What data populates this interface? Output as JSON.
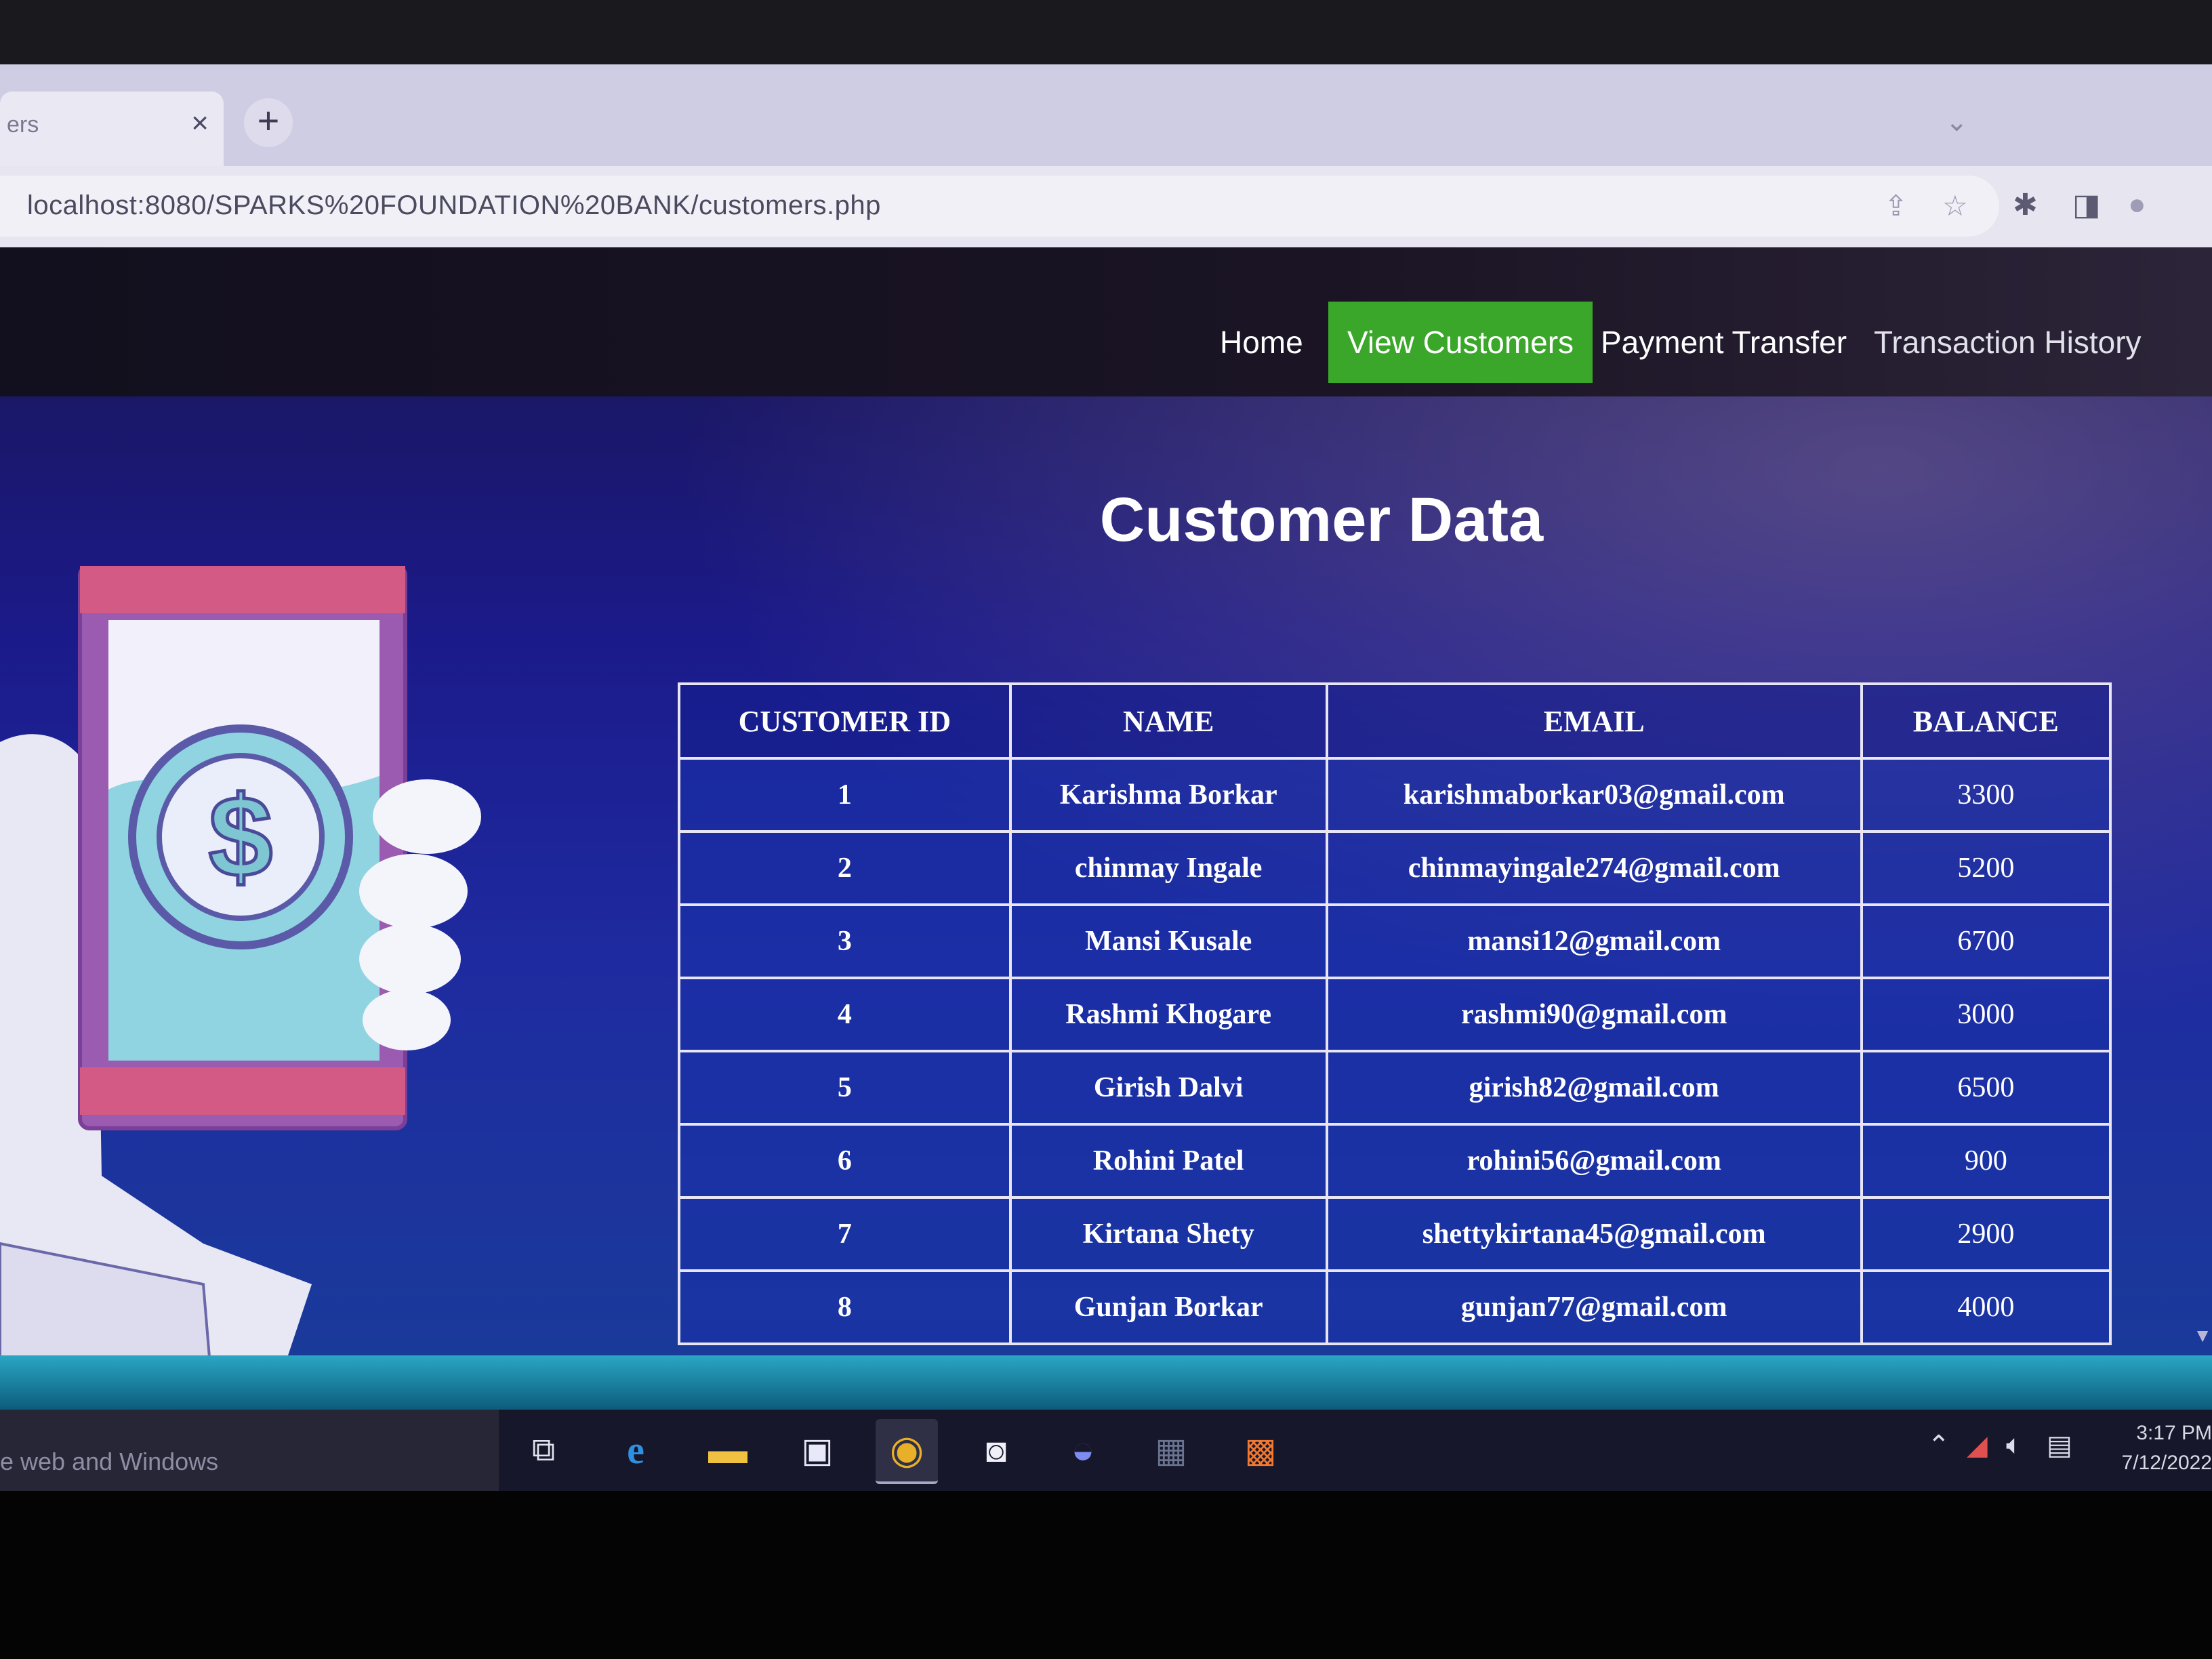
{
  "browser": {
    "tab": {
      "title": "ers",
      "close": "×"
    },
    "new_tab": "+",
    "tab_overflow": "⌄",
    "address": "localhost:8080/SPARKS%20FOUNDATION%20BANK/customers.php",
    "icons": [
      "share-icon",
      "star-icon",
      "extensions-icon",
      "sidebar-icon",
      "profile-icon"
    ]
  },
  "navbar": {
    "items": [
      {
        "label": "Home",
        "active": false
      },
      {
        "label": "View Customers",
        "active": true
      },
      {
        "label": "Payment Transfer",
        "active": false
      },
      {
        "label": "Transaction History",
        "active": false
      }
    ],
    "active_color": "#3aa72a"
  },
  "page": {
    "title": "Customer Data",
    "illustration": {
      "symbol": "$"
    }
  },
  "table": {
    "headers": [
      "CUSTOMER ID",
      "NAME",
      "EMAIL",
      "BALANCE"
    ],
    "rows": [
      {
        "id": "1",
        "name": "Karishma Borkar",
        "email": "karishmaborkar03@gmail.com",
        "balance": "3300"
      },
      {
        "id": "2",
        "name": "chinmay Ingale",
        "email": "chinmayingale274@gmail.com",
        "balance": "5200"
      },
      {
        "id": "3",
        "name": "Mansi Kusale",
        "email": "mansi12@gmail.com",
        "balance": "6700"
      },
      {
        "id": "4",
        "name": "Rashmi Khogare",
        "email": "rashmi90@gmail.com",
        "balance": "3000"
      },
      {
        "id": "5",
        "name": "Girish Dalvi",
        "email": "girish82@gmail.com",
        "balance": "6500"
      },
      {
        "id": "6",
        "name": "Rohini Patel",
        "email": "rohini56@gmail.com",
        "balance": "900"
      },
      {
        "id": "7",
        "name": "Kirtana Shety",
        "email": "shettykirtana45@gmail.com",
        "balance": "2900"
      },
      {
        "id": "8",
        "name": "Gunjan Borkar",
        "email": "gunjan77@gmail.com",
        "balance": "4000"
      }
    ]
  },
  "taskbar": {
    "search_text": "e web and Windows",
    "apps": [
      "task-view-icon",
      "edge-icon",
      "file-explorer-icon",
      "display-icon",
      "chrome-icon",
      "camera-icon",
      "media-icon",
      "app-icon",
      "xampp-icon"
    ],
    "clock": {
      "time": "3:17 PM",
      "date": "7/12/2022"
    }
  }
}
